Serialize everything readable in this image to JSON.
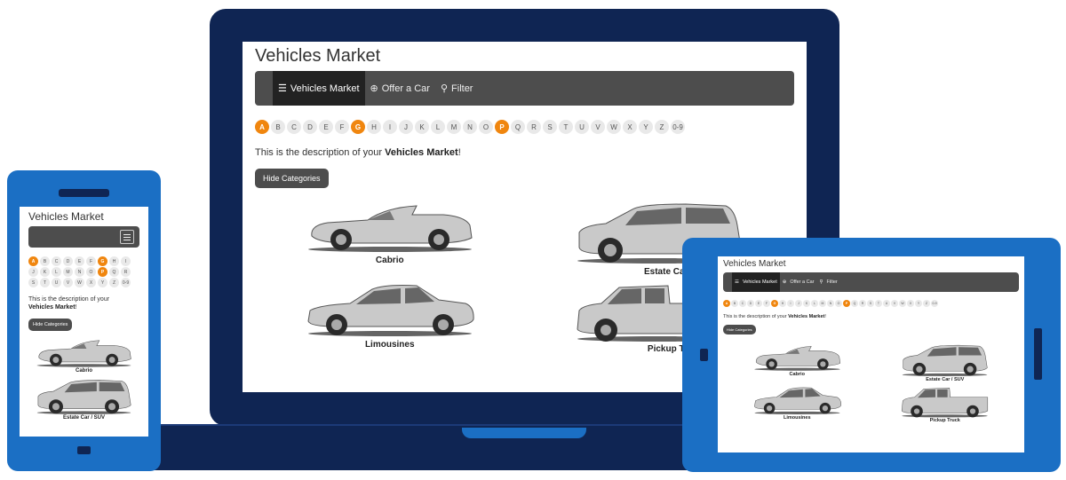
{
  "site": {
    "title": "Vehicles Market",
    "nav": {
      "vehicles_market": "Vehicles Market",
      "offer_car": "Offer a Car",
      "filter": "Filter"
    },
    "alphabet": [
      "A",
      "B",
      "C",
      "D",
      "E",
      "F",
      "G",
      "H",
      "I",
      "J",
      "K",
      "L",
      "M",
      "N",
      "O",
      "P",
      "Q",
      "R",
      "S",
      "T",
      "U",
      "V",
      "W",
      "X",
      "Y",
      "Z",
      "0-9"
    ],
    "alphabet_active": [
      "A",
      "G",
      "P"
    ],
    "description_prefix": "This is the description of your ",
    "description_bold": "Vehicles Market",
    "description_suffix": "!",
    "hide_categories": "Hide Categories",
    "categories": {
      "cabrio": "Cabrio",
      "estate": "Estate Car / SUV",
      "limousines": "Limousines",
      "pickup": "Pickup Truck"
    },
    "laptop_visible_labels": {
      "estate": "Estate Car / S",
      "pickup": "Pickup Truc"
    }
  },
  "colors": {
    "accent": "#f0860f",
    "navbar": "#4d4d4d",
    "device_dark": "#0f2553",
    "device_blue": "#1b6fc4"
  }
}
